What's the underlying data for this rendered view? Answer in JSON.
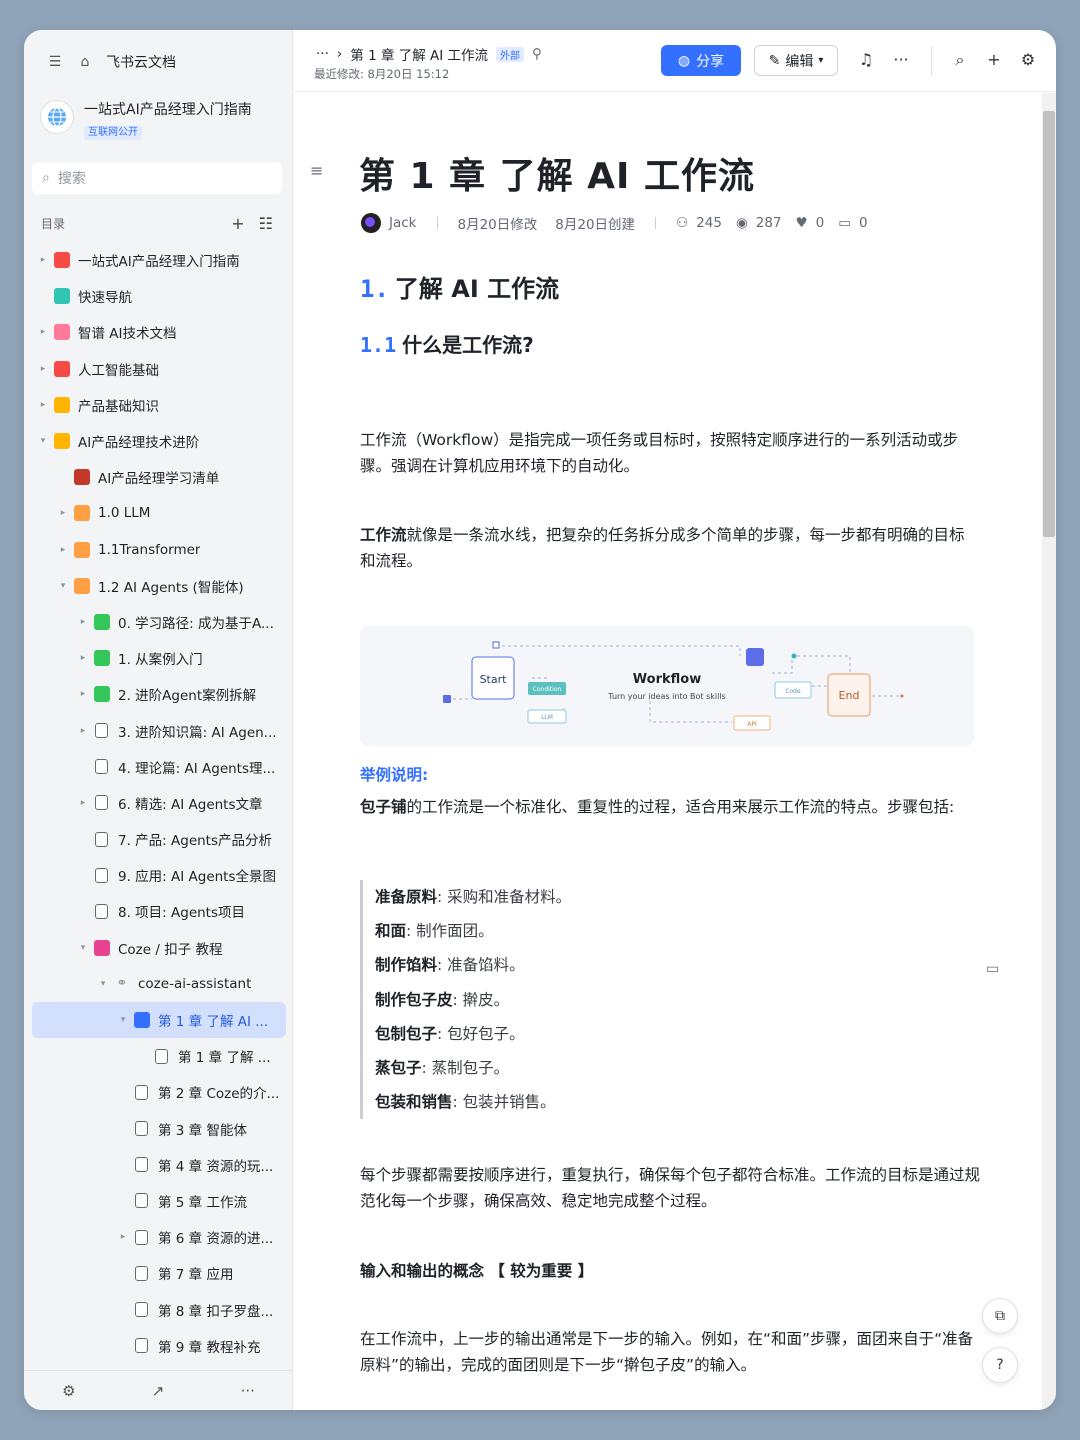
{
  "app": {
    "name": "飞书云文档"
  },
  "space": {
    "name": "一站式AI产品经理入门指南",
    "tag": "互联网公开"
  },
  "search": {
    "placeholder": "搜索"
  },
  "toc": {
    "label": "目录"
  },
  "tree": [
    {
      "label": "一站式AI产品经理入门指南",
      "arrow": "▸",
      "icon_color": "#f54a45",
      "indent": 0
    },
    {
      "label": "快速导航",
      "arrow": "",
      "icon_color": "#2ec4b6",
      "indent": 0
    },
    {
      "label": "智谱 AI技术文档",
      "arrow": "▸",
      "icon_color": "#ff7a9a",
      "indent": 0
    },
    {
      "label": "人工智能基础",
      "arrow": "▸",
      "icon_color": "#f54a45",
      "indent": 0
    },
    {
      "label": "产品基础知识",
      "arrow": "▸",
      "icon_color": "#ffb400",
      "indent": 0
    },
    {
      "label": "AI产品经理技术进阶",
      "arrow": "▾",
      "icon_color": "#ffb400",
      "indent": 0
    },
    {
      "label": "AI产品经理学习清单",
      "arrow": "",
      "icon_color": "#c0392b",
      "indent": 1
    },
    {
      "label": "1.0 LLM",
      "arrow": "▸",
      "icon_color": "#ff9f43",
      "indent": 1
    },
    {
      "label": "1.1Transformer",
      "arrow": "▸",
      "icon_color": "#ff9f43",
      "indent": 1
    },
    {
      "label": "1.2 AI Agents (智能体)",
      "arrow": "▾",
      "icon_color": "#ff9f43",
      "indent": 1
    },
    {
      "label": "0. 学习路径: 成为基于A...",
      "arrow": "▸",
      "icon_color": "#34c759",
      "indent": 2
    },
    {
      "label": "1. 从案例入门",
      "arrow": "▸",
      "icon_color": "#34c759",
      "indent": 2
    },
    {
      "label": "2. 进阶Agent案例拆解",
      "arrow": "▸",
      "icon_color": "#34c759",
      "indent": 2
    },
    {
      "label": "3. 进阶知识篇: AI Agen...",
      "arrow": "▸",
      "icon_color": "doc",
      "indent": 2
    },
    {
      "label": "4. 理论篇: AI Agents理...",
      "arrow": "",
      "icon_color": "doc",
      "indent": 2
    },
    {
      "label": "6. 精选: AI Agents文章",
      "arrow": "▸",
      "icon_color": "doc",
      "indent": 2
    },
    {
      "label": "7. 产品: Agents产品分析",
      "arrow": "",
      "icon_color": "doc",
      "indent": 2
    },
    {
      "label": "9. 应用: AI Agents全景图",
      "arrow": "",
      "icon_color": "doc",
      "indent": 2
    },
    {
      "label": "8. 项目: Agents项目",
      "arrow": "",
      "icon_color": "doc",
      "indent": 2
    },
    {
      "label": "Coze / 扣子 教程",
      "arrow": "▾",
      "icon_color": "#e84393",
      "indent": 2
    },
    {
      "label": "coze-ai-assistant",
      "arrow": "▾",
      "icon_color": "link",
      "indent": 3
    },
    {
      "label": "第 1 章 了解 AI ...",
      "arrow": "▾",
      "icon_color": "#3370ff",
      "indent": 4,
      "active": true
    },
    {
      "label": "第 1 章 了解 ...",
      "arrow": "",
      "icon_color": "doc",
      "indent": 5
    },
    {
      "label": "第 2 章 Coze的介...",
      "arrow": "",
      "icon_color": "doc",
      "indent": 4
    },
    {
      "label": "第 3 章 智能体",
      "arrow": "",
      "icon_color": "doc",
      "indent": 4
    },
    {
      "label": "第 4 章 资源的玩...",
      "arrow": "",
      "icon_color": "doc",
      "indent": 4
    },
    {
      "label": "第 5 章 工作流",
      "arrow": "",
      "icon_color": "doc",
      "indent": 4
    },
    {
      "label": "第 6 章 资源的进...",
      "arrow": "▸",
      "icon_color": "doc",
      "indent": 4
    },
    {
      "label": "第 7 章 应用",
      "arrow": "",
      "icon_color": "doc",
      "indent": 4
    },
    {
      "label": "第 8 章 扣子罗盘...",
      "arrow": "",
      "icon_color": "doc",
      "indent": 4
    },
    {
      "label": "第 9 章 教程补充",
      "arrow": "",
      "icon_color": "doc",
      "indent": 4
    }
  ],
  "topbar": {
    "breadcrumb_more": "···",
    "breadcrumb_title": "第 1 章 了解 AI 工作流",
    "external_tag": "外部",
    "modified": "最近修改: 8月20日 15:12",
    "share_label": "分享",
    "edit_label": "编辑"
  },
  "doc": {
    "title": "第 1 章 了解 AI 工作流",
    "author": "Jack",
    "modified": "8月20日修改",
    "created": "8月20日创建",
    "readers": "245",
    "views": "287",
    "likes": "0",
    "comments": "0",
    "h1_num": "1.",
    "h1_text": "了解 AI 工作流",
    "h2_num": "1.1",
    "h2_text": "什么是工作流?",
    "p1": "工作流（Workflow）是指完成一项任务或目标时，按照特定顺序进行的一系列活动或步骤。强调在计算机应用环境下的自动化。",
    "p2_bold": "工作流",
    "p2_rest": "就像是一条流水线，把复杂的任务拆分成多个简单的步骤，每一步都有明确的目标和流程。",
    "figure": {
      "start": "Start",
      "end": "End",
      "title": "Workflow",
      "subtitle": "Turn your ideas into Bot skills",
      "condition": "Condition",
      "llm": "LLM",
      "code": "Code",
      "api": "API"
    },
    "example_label": "举例说明:",
    "p3_bold": "包子铺",
    "p3_rest": "的工作流是一个标准化、重复性的过程，适合用来展示工作流的特点。步骤包括:",
    "steps": [
      {
        "name": "准备原料",
        "desc": ": 采购和准备材料。"
      },
      {
        "name": "和面",
        "desc": ": 制作面团。"
      },
      {
        "name": "制作馅料",
        "desc": ": 准备馅料。"
      },
      {
        "name": "制作包子皮",
        "desc": ": 擀皮。"
      },
      {
        "name": "包制包子",
        "desc": ": 包好包子。"
      },
      {
        "name": "蒸包子",
        "desc": ": 蒸制包子。"
      },
      {
        "name": "包装和销售",
        "desc": ": 包装并销售。"
      }
    ],
    "p4": "每个步骤都需要按顺序进行，重复执行，确保每个包子都符合标准。工作流的目标是通过规范化每一个步骤，确保高效、稳定地完成整个过程。",
    "h4": "输入和输出的概念 【 较为重要 】",
    "p5": "在工作流中，上一步的输出通常是下一步的输入。例如，在“和面”步骤，面团来自于“准备原料”的输出，完成的面团则是下一步“擀包子皮”的输入。"
  }
}
